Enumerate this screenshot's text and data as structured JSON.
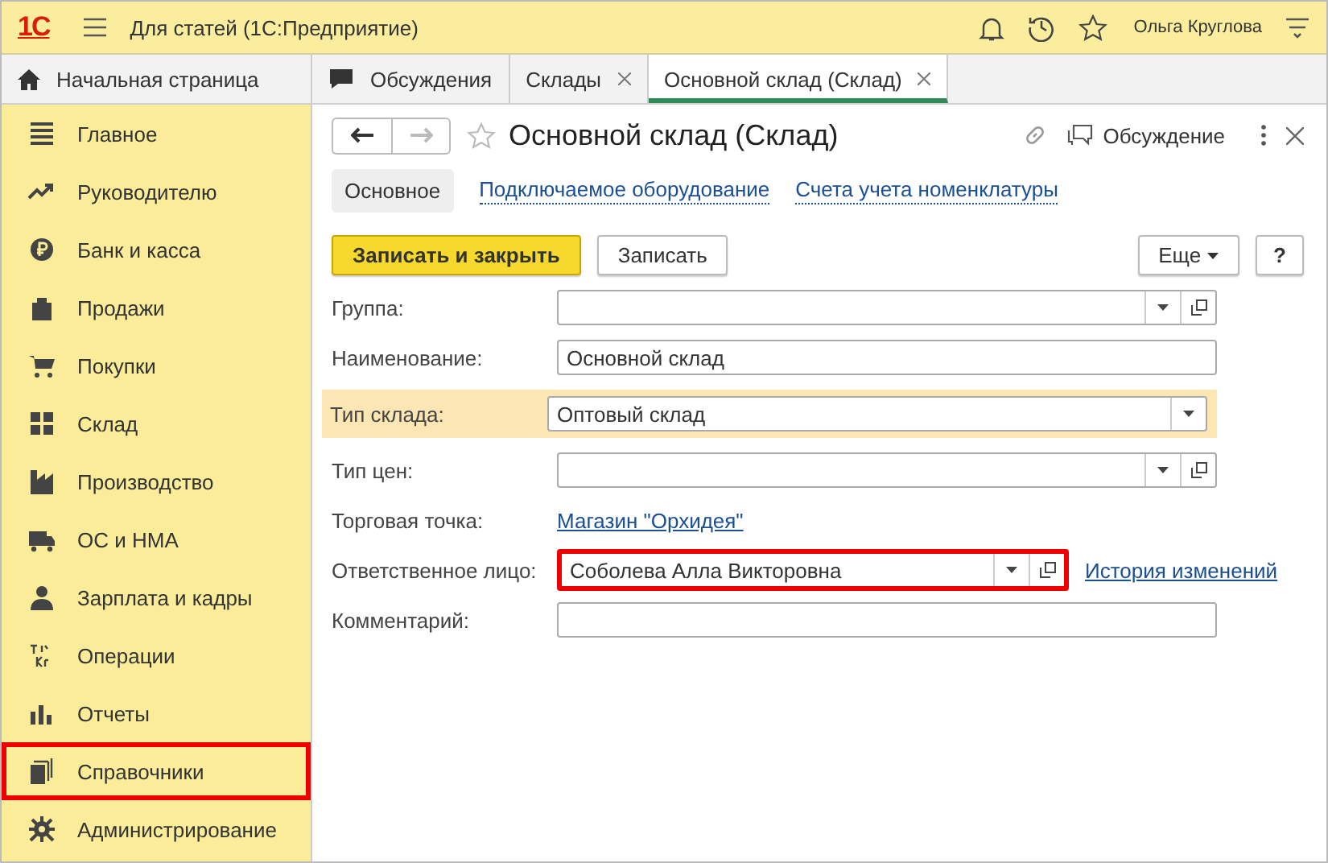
{
  "app": {
    "logo": "1С",
    "title": "Для статей  (1С:Предприятие)",
    "user": "Ольга Круглова"
  },
  "tabs": [
    {
      "label": "Начальная страница",
      "kind": "home",
      "closable": false,
      "selected": false
    },
    {
      "label": "Обсуждения",
      "kind": "chat",
      "closable": false,
      "selected": false
    },
    {
      "label": "Склады",
      "kind": "plain",
      "closable": true,
      "selected": false
    },
    {
      "label": "Основной склад (Склад)",
      "kind": "plain",
      "closable": true,
      "selected": true
    }
  ],
  "sidebar": {
    "items": [
      {
        "label": "Главное",
        "marked": false
      },
      {
        "label": "Руководителю",
        "marked": false
      },
      {
        "label": "Банк и касса",
        "marked": false
      },
      {
        "label": "Продажи",
        "marked": false
      },
      {
        "label": "Покупки",
        "marked": false
      },
      {
        "label": "Склад",
        "marked": false
      },
      {
        "label": "Производство",
        "marked": false
      },
      {
        "label": "ОС и НМА",
        "marked": false
      },
      {
        "label": "Зарплата и кадры",
        "marked": false
      },
      {
        "label": "Операции",
        "marked": false
      },
      {
        "label": "Отчеты",
        "marked": false
      },
      {
        "label": "Справочники",
        "marked": true
      },
      {
        "label": "Администрирование",
        "marked": false
      }
    ]
  },
  "form": {
    "title": "Основной склад (Склад)",
    "forward_disabled": true,
    "discussion": "Обсуждение",
    "sections": [
      {
        "label": "Основное",
        "selected": true
      },
      {
        "label": "Подключаемое оборудование",
        "selected": false
      },
      {
        "label": "Счета учета номенклатуры",
        "selected": false
      }
    ],
    "buttons": [
      {
        "label": "Записать и закрыть",
        "kind": "primary"
      },
      {
        "label": "Записать",
        "kind": "normal"
      }
    ],
    "more": "Еще",
    "help": "?",
    "fields": [
      {
        "label": "Группа:",
        "kind": "ref",
        "highlighted": false,
        "marked": false
      },
      {
        "label": "Наименование:",
        "kind": "text",
        "value": "Основной склад",
        "highlighted": false,
        "marked": false
      },
      {
        "label": "Тип склада:",
        "kind": "select",
        "value": "Оптовый склад",
        "highlighted": true,
        "marked": false
      },
      {
        "label": "Тип цен:",
        "kind": "ref",
        "highlighted": false,
        "marked": false
      },
      {
        "label": "Торговая точка:",
        "kind": "link",
        "value": "Магазин \"Орхидея\"",
        "highlighted": false,
        "marked": false
      },
      {
        "label": "Ответственное лицо:",
        "kind": "ref",
        "value": "Соболева Алла Викторовна",
        "highlighted": false,
        "marked": true,
        "side_link": "История изменений"
      },
      {
        "label": "Комментарий:",
        "kind": "text",
        "highlighted": false,
        "marked": false
      }
    ]
  }
}
